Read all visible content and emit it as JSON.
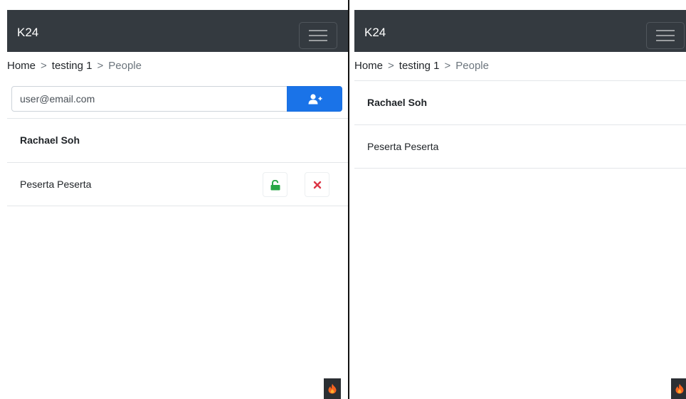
{
  "left": {
    "navbar": {
      "brand": "K24",
      "menu_icon": "hamburger-menu-icon"
    },
    "breadcrumb": {
      "home": "Home",
      "separator1": ">",
      "course": "testing 1",
      "separator2": ">",
      "current": "People"
    },
    "add_user": {
      "placeholder": "user@email.com",
      "button_icon": "add-user-icon"
    },
    "people": [
      {
        "name": "Rachael Soh",
        "bold": true
      },
      {
        "name": "Peserta Peserta",
        "bold": false,
        "actions": [
          "unlock-icon",
          "close-icon"
        ]
      }
    ],
    "badge_icon": "fire-icon"
  },
  "right": {
    "navbar": {
      "brand": "K24",
      "menu_icon": "hamburger-menu-icon"
    },
    "breadcrumb": {
      "home": "Home",
      "separator1": ">",
      "course": "testing 1",
      "separator2": ">",
      "current": "People"
    },
    "people": [
      {
        "name": "Rachael Soh",
        "bold": true
      },
      {
        "name": "Peserta Peserta",
        "bold": false
      }
    ],
    "badge_icon": "fire-icon"
  },
  "colors": {
    "navbar_bg": "#343a40",
    "primary": "#1a73e8",
    "success": "#28a745",
    "danger": "#dc3545",
    "muted": "#6c757d",
    "fire": "#f5631f"
  }
}
